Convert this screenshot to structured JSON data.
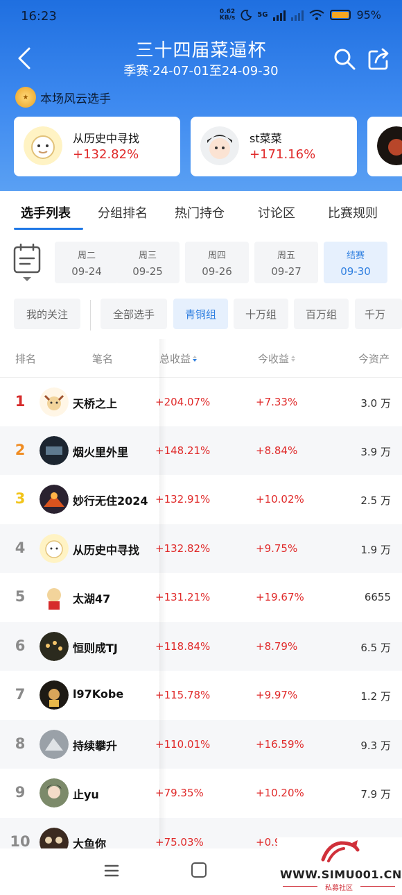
{
  "status": {
    "time": "16:23",
    "net_speed": "0.62",
    "net_unit": "KB/s",
    "network": "5G",
    "battery": "95%"
  },
  "header": {
    "title": "三十四届菜逼杯",
    "subtitle": "季赛·24-07-01至24-09-30"
  },
  "star_section": {
    "label": "本场风云选手"
  },
  "star_cards": [
    {
      "name": "从历史中寻找",
      "pct": "+132.82%"
    },
    {
      "name": "st菜菜",
      "pct": "+171.16%"
    }
  ],
  "tabs": [
    "选手列表",
    "分组排名",
    "热门持仓",
    "讨论区",
    "比赛规则"
  ],
  "dates": [
    {
      "weekday": "周二",
      "date": "09-24"
    },
    {
      "weekday": "周三",
      "date": "09-25"
    },
    {
      "weekday": "周四",
      "date": "09-26"
    },
    {
      "weekday": "周五",
      "date": "09-27"
    },
    {
      "weekday": "结赛",
      "date": "09-30"
    }
  ],
  "filters": {
    "follow": "我的关注",
    "groups": [
      "全部选手",
      "青铜组",
      "十万组",
      "百万组",
      "千万"
    ]
  },
  "table_headers": {
    "rank": "排名",
    "name": "笔名",
    "total": "总收益",
    "today": "今收益",
    "asset": "今资产"
  },
  "rows": [
    {
      "rank": "1",
      "name": "天桥之上",
      "total": "+204.07%",
      "today": "+7.33%",
      "asset": "3.0 万"
    },
    {
      "rank": "2",
      "name": "烟火里外里",
      "total": "+148.21%",
      "today": "+8.84%",
      "asset": "3.9 万"
    },
    {
      "rank": "3",
      "name": "妙行无住2024",
      "total": "+132.91%",
      "today": "+10.02%",
      "asset": "2.5 万"
    },
    {
      "rank": "4",
      "name": "从历史中寻找",
      "total": "+132.82%",
      "today": "+9.75%",
      "asset": "1.9 万"
    },
    {
      "rank": "5",
      "name": "太湖47",
      "total": "+131.21%",
      "today": "+19.67%",
      "asset": "6655"
    },
    {
      "rank": "6",
      "name": "恒则成TJ",
      "total": "+118.84%",
      "today": "+8.79%",
      "asset": "6.5 万"
    },
    {
      "rank": "7",
      "name": "l97Kobe",
      "total": "+115.78%",
      "today": "+9.97%",
      "asset": "1.2 万"
    },
    {
      "rank": "8",
      "name": "持续攀升",
      "total": "+110.01%",
      "today": "+16.59%",
      "asset": "9.3 万"
    },
    {
      "rank": "9",
      "name": "止yu",
      "total": "+79.35%",
      "today": "+10.20%",
      "asset": "7.9 万"
    },
    {
      "rank": "10",
      "name": "大鱼你",
      "total": "+75.03%",
      "today": "+0.9",
      "asset": ""
    }
  ],
  "watermark": {
    "text": "WWW.SIMU001.CN",
    "sub": "私募社区"
  }
}
